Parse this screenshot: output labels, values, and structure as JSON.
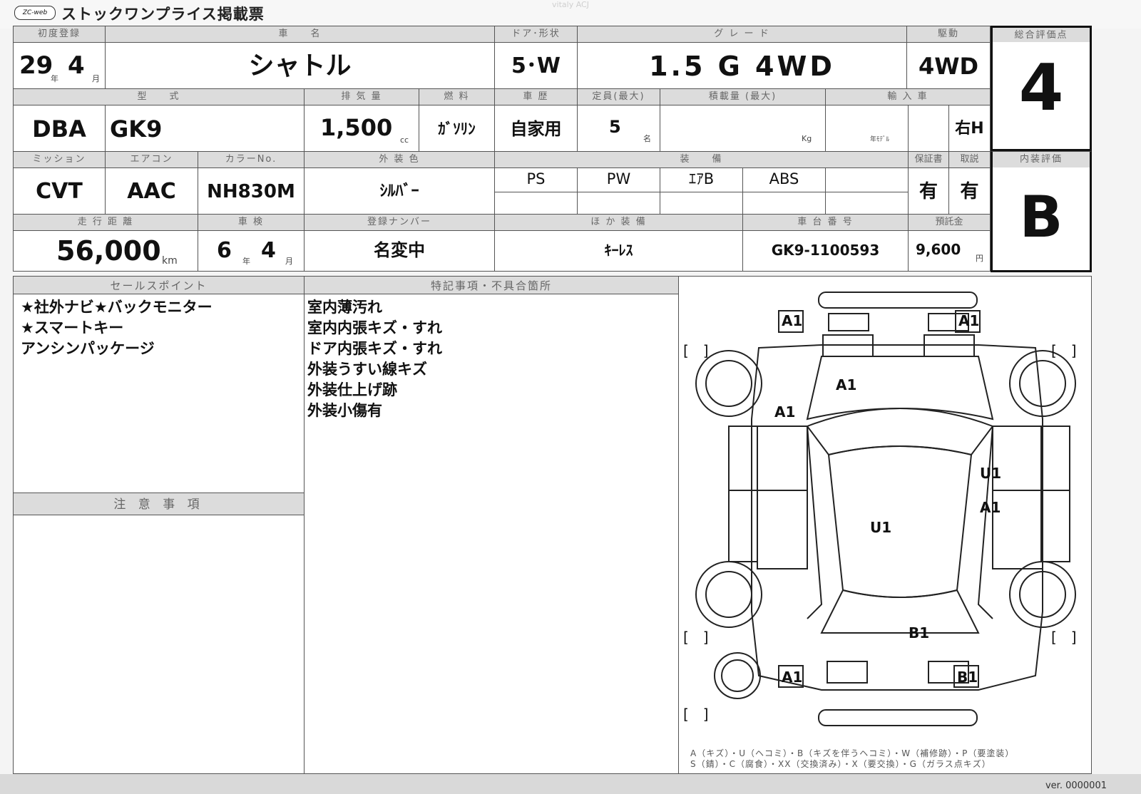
{
  "watermark": "vitaly ACJ",
  "logo_text": "ZC-web",
  "sheet_title": "ストックワンプライス掲載票",
  "version": "ver. 0000001",
  "row1": {
    "h_first_reg": "初度登録",
    "h_car_name": "車　　名",
    "h_door_shape": "ドア･形状",
    "h_grade": "グ レ ー ド",
    "h_drive": "駆動",
    "h_score": "総合評価点",
    "first_reg_year": "29",
    "unit_year": "年",
    "first_reg_month": "4",
    "unit_month": "月",
    "car_name": "シャトル",
    "door_shape": "5･W",
    "grade": "1.5 G 4WD",
    "drive": "4WD",
    "score": "4"
  },
  "row2": {
    "h_model_type": "型　　式",
    "h_displacement": "排 気 量",
    "h_fuel": "燃 料",
    "h_vehicle_use": "車 歴",
    "h_capacity": "定員(最大)",
    "h_load": "積載量 (最大)",
    "h_import": "輸 入 車",
    "model_prefix": "DBA",
    "model": "GK9",
    "displacement": "1,500",
    "unit_cc": "cc",
    "fuel": "ｶﾞｿﾘﾝ",
    "vehicle_use": "自家用",
    "capacity": "5",
    "unit_person": "名",
    "unit_kg": "Kg",
    "model_year_label": "年ﾓﾃﾞﾙ",
    "steering": "右H"
  },
  "row3": {
    "h_mission": "ミッション",
    "h_aircon": "エアコン",
    "h_color_no": "カラーNo.",
    "h_exterior": "外 装 色",
    "h_equipment": "装　　備",
    "h_warranty": "保証書",
    "h_manual": "取説",
    "h_interior": "内装評価",
    "mission": "CVT",
    "aircon": "AAC",
    "color_no": "NH830M",
    "exterior": "ｼﾙﾊﾞｰ",
    "equipment": [
      "PS",
      "PW",
      "ｴｱB",
      "ABS",
      ""
    ],
    "warranty": "有",
    "manual": "有",
    "interior": "B"
  },
  "row4": {
    "h_mileage": "走 行 距 離",
    "h_inspection": "車 検",
    "h_plate": "登録ナンバー",
    "h_other_equip": "ほ か 装 備",
    "h_chassis": "車 台 番 号",
    "h_recycle": "預託金",
    "mileage": "56,000",
    "unit_km": "km",
    "insp_year": "6",
    "unit_year": "年",
    "insp_month": "4",
    "unit_month": "月",
    "plate": "名変中",
    "other_equip": "ｷｰﾚｽ",
    "chassis": "GK9-1100593",
    "recycle": "9,600",
    "unit_yen": "円"
  },
  "panels": {
    "sales_header": "セールスポイント",
    "sales_points": [
      "★社外ナビ★バックモニター",
      "★スマートキー",
      "アンシンパッケージ"
    ],
    "notes_header": "特記事項・不具合箇所",
    "notes": [
      "室内薄汚れ",
      "室内内張キズ・すれ",
      "ドア内張キズ・すれ",
      "外装うすい線キズ",
      "外装仕上げ跡",
      "外装小傷有"
    ],
    "caution_header": "注 意 事 項"
  },
  "diagram": {
    "marks": [
      {
        "code": "A1",
        "where": "front-left"
      },
      {
        "code": "A1",
        "where": "front-right"
      },
      {
        "code": "A1",
        "where": "hood"
      },
      {
        "code": "A1",
        "where": "left-fender"
      },
      {
        "code": "U1",
        "where": "right-rear-door"
      },
      {
        "code": "A1",
        "where": "right-rear-door"
      },
      {
        "code": "U1",
        "where": "roof"
      },
      {
        "code": "B1",
        "where": "rear-right"
      },
      {
        "code": "A1",
        "where": "rear-left"
      },
      {
        "code": "B1",
        "where": "rear-bumper-right"
      }
    ],
    "bracket": "[　]",
    "legend_line1": "A（キズ）・U（ヘコミ）・B（キズを伴うヘコミ）・W（補修跡）・P（要塗装）",
    "legend_line2": "S（錆）・C（腐食）・XX（交換済み）・X（要交換）・G（ガラス点キズ）"
  }
}
